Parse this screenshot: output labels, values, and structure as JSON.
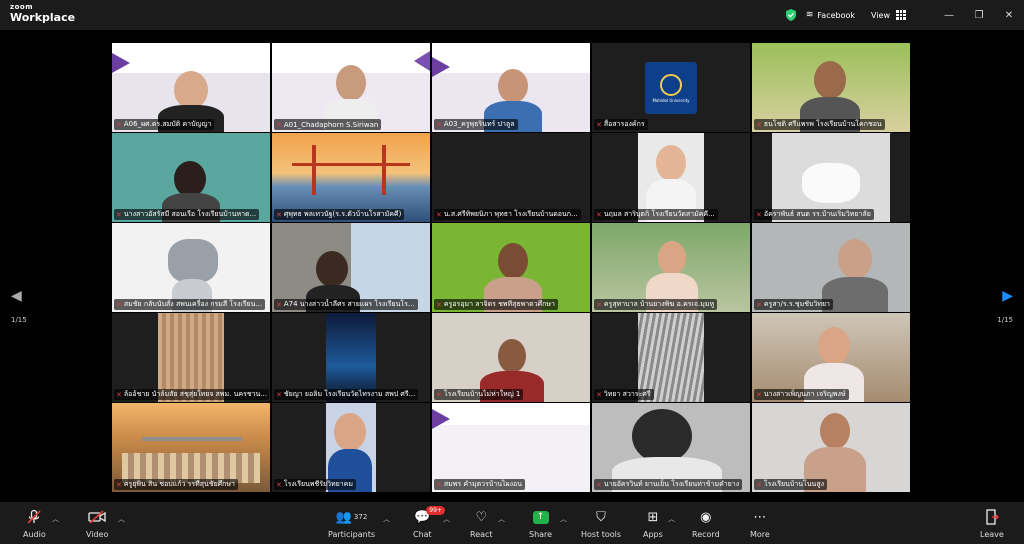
{
  "app": {
    "brand_line1": "zoom",
    "brand_line2": "Workplace"
  },
  "topbar": {
    "facebook_label": "Facebook",
    "view_label": "View",
    "minimize": "—",
    "restore": "❐",
    "close": "✕"
  },
  "pager": {
    "left_page": "1/15",
    "right_page": "1/15"
  },
  "tiles": [
    {
      "name": "A06_ผศ.ดร.สมบัติ คาบัญญา"
    },
    {
      "name": "A01_Chadaphorn S.Siriwan"
    },
    {
      "name": "A03_ครูพุธรินทร์ ปาลูล"
    },
    {
      "name": "สื่อสารองค์กร",
      "logo_text": "Mahidol University"
    },
    {
      "name": "ธนโชติ ศรีแพรพ โรงเรียนบ้านโคกชอน"
    },
    {
      "name": "นางสาวอัสรัสมี สอนเรือ โรงเรียนบ้านหาด..."
    },
    {
      "name": "ศุพุทธ พลเทวนัฐ(ร.ร.ตัวบ้านโรสามัคคี)"
    },
    {
      "name": "น.ส.ศรีทิพยนิภา พุทธา โรงเรียนบ้านดอนก..."
    },
    {
      "name": "นฤมล สาริบุตกิ โรงเรียนวัดสามัคคี..."
    },
    {
      "name": "อัคราพันธ์ สนต รร.บ้านเริ่มวิทยาลัย"
    },
    {
      "name": "สมชัย กลับนับสั่ง สพนเครื่อง กรมสี โรงเรียน..."
    },
    {
      "name": "A74 นางสาวน้ำลีศร สายแผร โรงเรียนโร..."
    },
    {
      "name": "ครูอรอุมา ลาจิตร ชพทีสุธพาตวศึกษา"
    },
    {
      "name": "ครูสุทาบาล บ้านยางพิฆ อ.ครเจ.มุมหู"
    },
    {
      "name": "ครูสา/ร.ร.ชุมชับวิทยา"
    },
    {
      "name": "ล้ออ้ชาย นำล้มสัย สชุสุ่ยใทยจ สพม. นครชาน..."
    },
    {
      "name": "ชัยญา ยอลิม โรงเรียนวัดไทรงาม สพป ศรี..."
    },
    {
      "name": "โรงเรียนบ้านไม่ห่าใหญ่ 1"
    },
    {
      "name": "วิทยา สวาระศรี"
    },
    {
      "name": "นางสาวเพ็ญนภา เจริญพงษ์"
    },
    {
      "name": "ครูยุพิน สิน ชอบแก้ว รรทีสุนชัยศึกษา"
    },
    {
      "name": "โรงเรียนพชีรัยวิทยาคม"
    },
    {
      "name": "สมพร คำมุตวรบ้านไผงอน"
    },
    {
      "name": "นายอัครวินท์ ยานเย็น โรงเรียนท่าข้ามคำยาง"
    },
    {
      "name": "โรงเรียนบ้านโนนสูง"
    }
  ],
  "controls": {
    "audio": "Audio",
    "video": "Video",
    "participants": "Participants",
    "participants_count": "372",
    "chat": "Chat",
    "chat_badge": "99+",
    "react": "React",
    "share": "Share",
    "host_tools": "Host tools",
    "apps": "Apps",
    "record": "Record",
    "more": "More",
    "leave": "Leave"
  },
  "colors": {
    "active_speaker": "#2ecc71",
    "muted": "#e23b3b",
    "share": "#22b24c",
    "accent": "#1a8cff"
  }
}
